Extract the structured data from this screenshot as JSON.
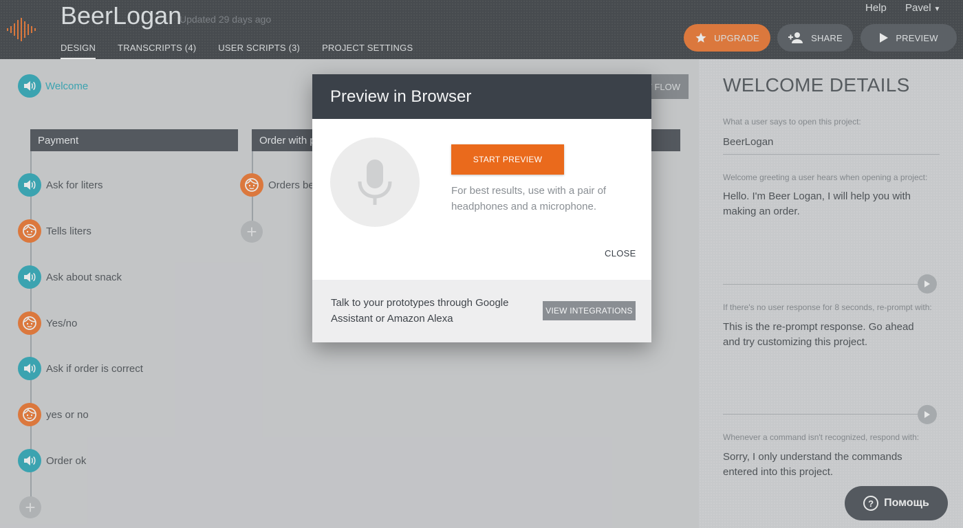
{
  "header": {
    "app_title": "BeerLogan",
    "updated": "Updated 29 days ago",
    "help": "Help",
    "user": "Pavel",
    "tabs": [
      {
        "label": "DESIGN"
      },
      {
        "label": "TRANSCRIPTS (4)"
      },
      {
        "label": "USER SCRIPTS (3)"
      },
      {
        "label": "PROJECT SETTINGS"
      }
    ],
    "upgrade_label": "UPGRADE",
    "share_label": "SHARE",
    "preview_label": "PREVIEW"
  },
  "canvas": {
    "welcome_label": "Welcome",
    "flow_button_label": "V FLOW",
    "columns": [
      {
        "title": "Payment",
        "nodes": [
          {
            "type": "speaker",
            "label": "Ask for liters"
          },
          {
            "type": "user",
            "label": "Tells liters"
          },
          {
            "type": "speaker",
            "label": "Ask about snack"
          },
          {
            "type": "user",
            "label": "Yes/no"
          },
          {
            "type": "speaker",
            "label": "Ask if order is correct"
          },
          {
            "type": "user",
            "label": "yes or no"
          },
          {
            "type": "speaker",
            "label": "Order ok"
          }
        ]
      },
      {
        "title": "Order with p",
        "nodes": [
          {
            "type": "user",
            "label": "Orders be"
          }
        ]
      }
    ]
  },
  "panel": {
    "title": "WELCOME DETAILS",
    "open_label": "What a user says to open this project:",
    "open_value": "BeerLogan",
    "greeting_label": "Welcome greeting a user hears when opening a project:",
    "greeting_value": "Hello. I'm Beer Logan, I will help you with making an order.",
    "reprompt_label": "If there's no user response for 8 seconds, re-prompt with:",
    "reprompt_value": "This is the re-prompt response. Go ahead and try customizing this project.",
    "fallback_label": "Whenever a command isn't recognized, respond with:",
    "fallback_value": "Sorry, I only understand the commands entered into this project."
  },
  "help_bubble": {
    "q": "?",
    "label": "Помощь"
  },
  "modal": {
    "title": "Preview in Browser",
    "start_label": "START PREVIEW",
    "note": "For best results, use with a pair of headphones and a microphone.",
    "close_label": "CLOSE",
    "footer_text": "Talk to your prototypes through Google Assistant or Amazon Alexa",
    "integrations_label": "VIEW INTEGRATIONS"
  },
  "colors": {
    "accent_orange": "#ef6a1b",
    "accent_teal": "#1aa3b5",
    "header_dark": "#2a2e33"
  }
}
